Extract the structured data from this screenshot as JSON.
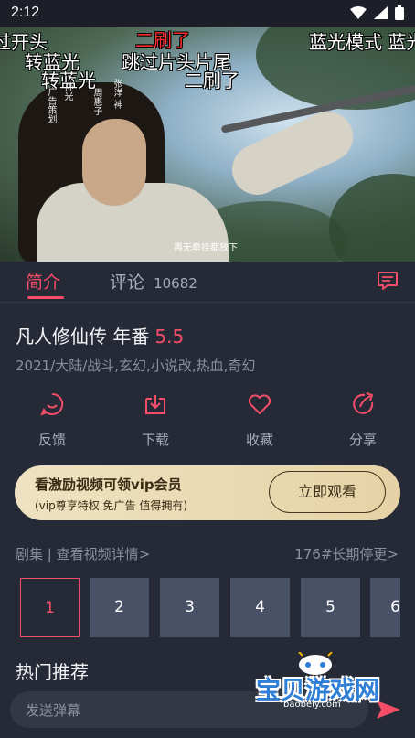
{
  "status": {
    "time": "2:12"
  },
  "video": {
    "danmaku": [
      {
        "id": "d1",
        "text": "过开头",
        "red": false
      },
      {
        "id": "d2",
        "text": "二刷了",
        "red": true
      },
      {
        "id": "d3",
        "text": "蓝光模式 蓝光",
        "red": false
      },
      {
        "id": "d4",
        "text": "转蓝光",
        "red": false
      },
      {
        "id": "d5",
        "text": "跳过片头片尾",
        "red": false
      },
      {
        "id": "d6",
        "text": "转蓝光",
        "red": false
      },
      {
        "id": "d7",
        "text": "二刷了",
        "red": false
      }
    ],
    "credits": [
      "广告策划",
      "孙光",
      "周惠子",
      "张洋 神"
    ],
    "subtitle": "再无牵挂都放下"
  },
  "tabs": {
    "intro": "简介",
    "comments": "评论",
    "comment_count": "10682"
  },
  "info": {
    "title": "凡人修仙传 年番",
    "score": "5.5",
    "tags": "2021/大陆/战斗,玄幻,小说改,热血,奇幻"
  },
  "actions": [
    {
      "label": "反馈",
      "icon": "feedback-icon"
    },
    {
      "label": "下载",
      "icon": "download-icon"
    },
    {
      "label": "收藏",
      "icon": "heart-icon"
    },
    {
      "label": "分享",
      "icon": "share-icon"
    }
  ],
  "banner": {
    "title": "看激励视频可领vip会员",
    "subtitle": "(vip尊享特权 免广告 值得拥有)",
    "button": "立即观看"
  },
  "episodes": {
    "header": "剧集 | 查看视频详情>",
    "status": "176#长期停更>",
    "items": [
      "1",
      "2",
      "3",
      "4",
      "5",
      "6"
    ],
    "active_index": 0
  },
  "section_hot": "热门推荐",
  "input": {
    "placeholder": "发送弹幕"
  },
  "watermark": {
    "main": "宝贝游戏网",
    "url": "baobeiy.com"
  },
  "colors": {
    "accent": "#f34d67",
    "background": "#262a36",
    "banner": "#e8d7ad"
  }
}
